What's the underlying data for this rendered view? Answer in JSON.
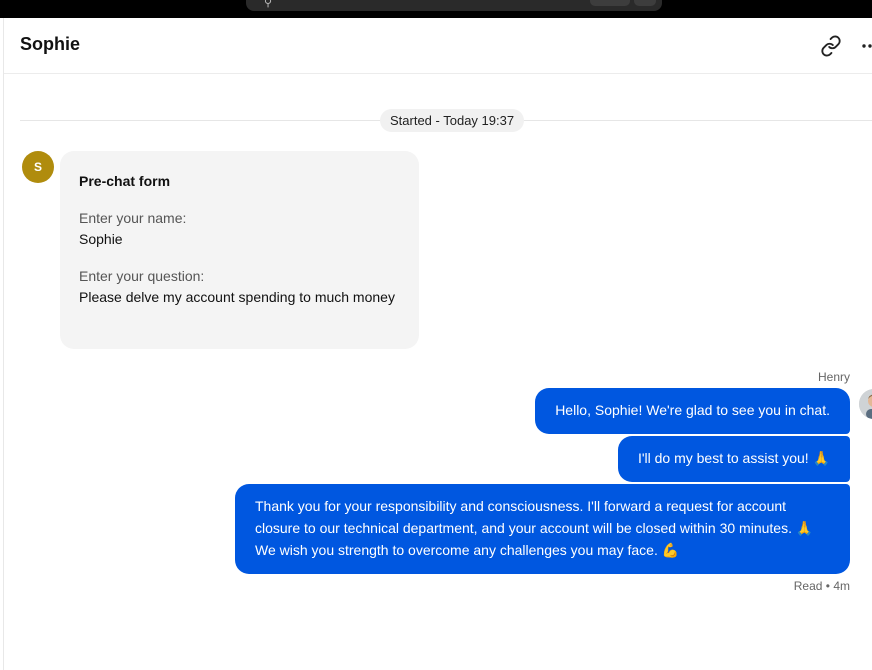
{
  "header": {
    "title": "Sophie",
    "link_icon": "link-icon",
    "more_icon": "more-horizontal-icon"
  },
  "conversation": {
    "started_label": "Started - Today 19:37"
  },
  "customer": {
    "avatar_initial": "S",
    "avatar_color": "#b08c0d"
  },
  "prechat_form": {
    "title": "Pre-chat form",
    "fields": [
      {
        "label": "Enter your name:",
        "value": "Sophie"
      },
      {
        "label": "Enter your question:",
        "value": "Please delve my account spending to much money"
      }
    ]
  },
  "agent": {
    "name": "Henry"
  },
  "messages": [
    {
      "text": "Hello, Sophie! We're glad to see you in chat."
    },
    {
      "text": "I'll do my best to assist you! 🙏"
    },
    {
      "text": "Thank you for your responsibility and consciousness. I'll forward a request for account closure to our technical department, and your account will be closed within 30 minutes. 🙏 We wish you strength to overcome any challenges you may face. 💪"
    }
  ],
  "read_status": "Read • 4m",
  "colors": {
    "accent": "#0057e0",
    "form_background": "#f4f4f4"
  }
}
